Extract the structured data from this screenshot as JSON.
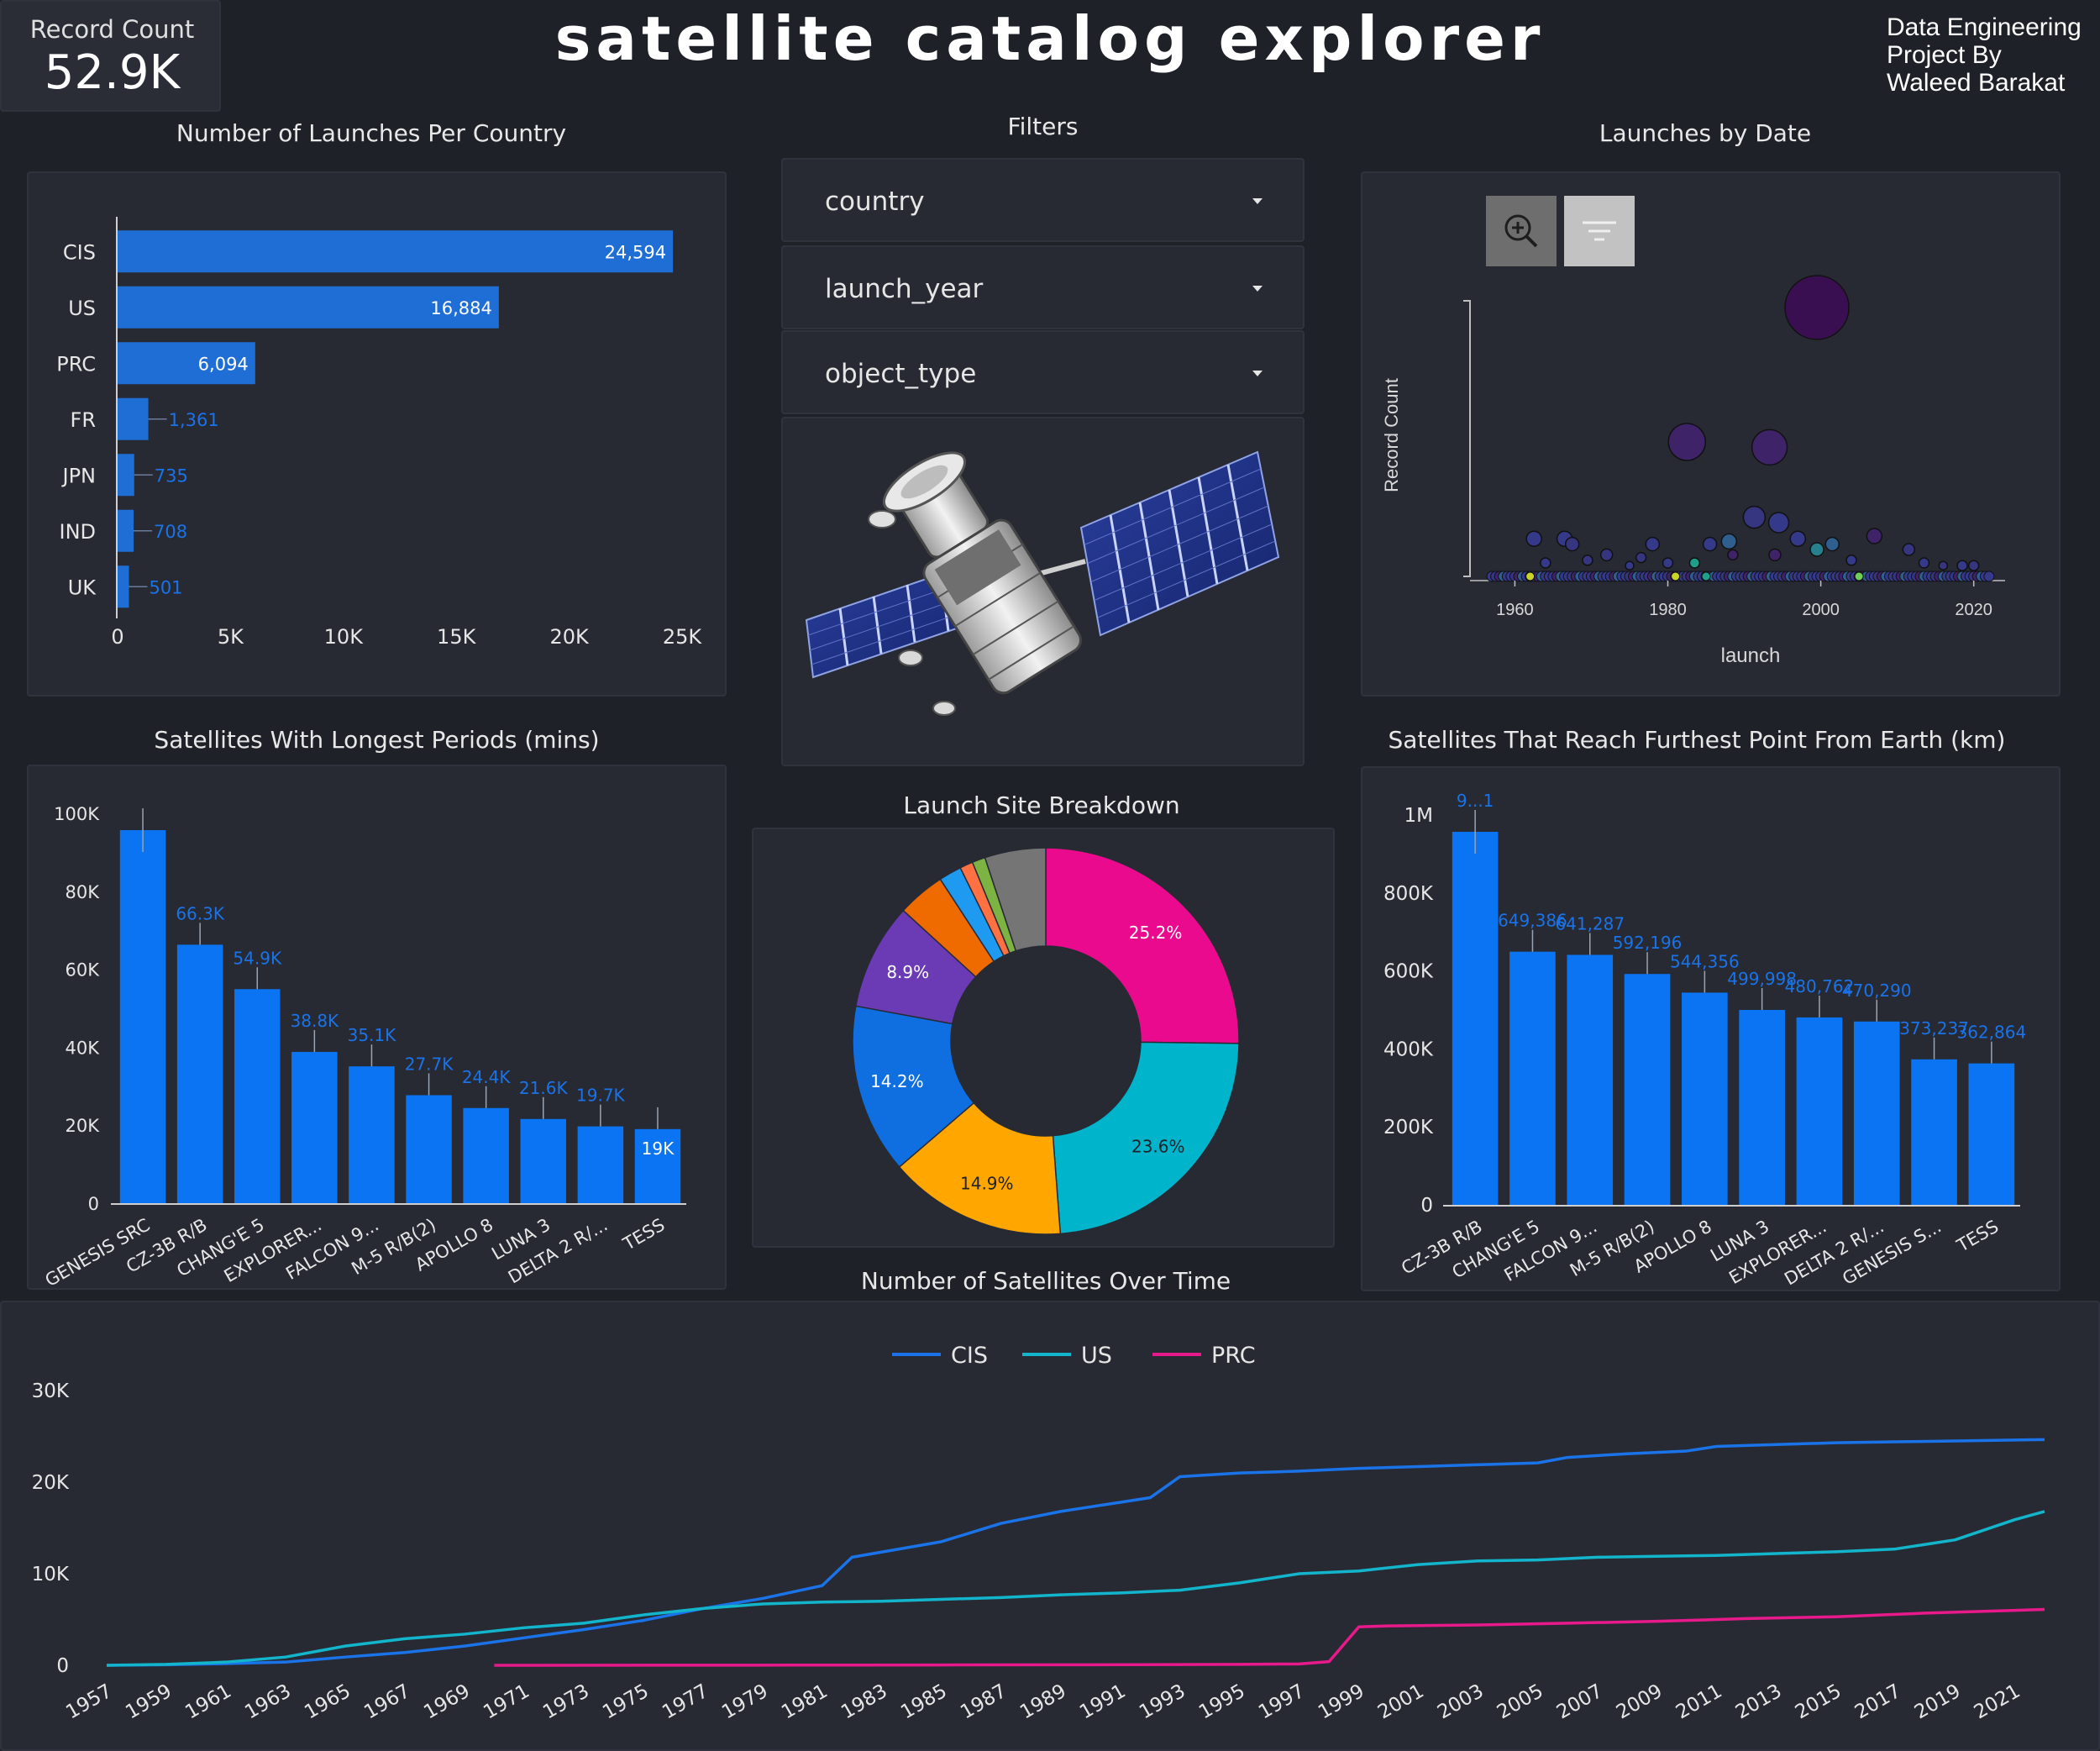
{
  "header": {
    "title": "satellite catalog explorer",
    "kpi_label": "Record Count",
    "kpi_value": "52.9K",
    "credits": [
      "Data Engineering",
      "Project By",
      "Waleed Barakat"
    ]
  },
  "filters": {
    "title": "Filters",
    "items": [
      "country",
      "launch_year",
      "object_type"
    ]
  },
  "colors": {
    "bg": "#1f2128",
    "panel": "#272a33",
    "bar_dark": "#1e6ed6",
    "bar_bright": "#0b74f2",
    "cis": "#1a73e8",
    "us": "#12b5cb",
    "prc": "#e8198b"
  },
  "chart_data": [
    {
      "id": "launches_per_country",
      "type": "bar",
      "orientation": "horizontal",
      "title": "Number of Launches Per Country",
      "categories": [
        "CIS",
        "US",
        "PRC",
        "FR",
        "JPN",
        "IND",
        "UK"
      ],
      "values": [
        24594,
        16884,
        6094,
        1361,
        735,
        708,
        501
      ],
      "value_labels": [
        "24,594",
        "16,884",
        "6,094",
        "1,361",
        "735",
        "708",
        "501"
      ],
      "xlim": [
        0,
        25000
      ],
      "xticks": [
        0,
        5000,
        10000,
        15000,
        20000,
        25000
      ],
      "xtick_labels": [
        "0",
        "5K",
        "10K",
        "15K",
        "20K",
        "25K"
      ]
    },
    {
      "id": "launches_by_date",
      "type": "scatter",
      "title": "Launches by Date",
      "xlabel": "launch",
      "ylabel": "Record Count",
      "xtick_labels": [
        "1960",
        "1980",
        "2000",
        "2020"
      ],
      "xticks": [
        1960,
        1980,
        2000,
        2020
      ],
      "xlim": [
        1956,
        2023
      ],
      "points": [
        {
          "x": 1999.5,
          "y": 10.0,
          "r": 38,
          "color": "#3a0f52"
        },
        {
          "x": 1982.5,
          "y": 5.0,
          "r": 22,
          "color": "#3e2369"
        },
        {
          "x": 1993.3,
          "y": 4.8,
          "r": 21,
          "color": "#3e2369"
        },
        {
          "x": 1991.3,
          "y": 2.2,
          "r": 13,
          "color": "#36357f"
        },
        {
          "x": 1994.5,
          "y": 2.0,
          "r": 12,
          "color": "#34398a"
        },
        {
          "x": 1962.5,
          "y": 1.4,
          "r": 9,
          "color": "#34398a"
        },
        {
          "x": 1966.5,
          "y": 1.4,
          "r": 9,
          "color": "#34398a"
        },
        {
          "x": 1967.5,
          "y": 1.2,
          "r": 8,
          "color": "#36357f"
        },
        {
          "x": 1978.0,
          "y": 1.2,
          "r": 8,
          "color": "#34398a"
        },
        {
          "x": 1985.5,
          "y": 1.2,
          "r": 8,
          "color": "#34398a"
        },
        {
          "x": 1988.0,
          "y": 1.3,
          "r": 9,
          "color": "#2f5f8e"
        },
        {
          "x": 1997.0,
          "y": 1.4,
          "r": 9,
          "color": "#34398a"
        },
        {
          "x": 2001.5,
          "y": 1.2,
          "r": 8,
          "color": "#2f5f8e"
        },
        {
          "x": 1999.5,
          "y": 1.0,
          "r": 8,
          "color": "#27808d"
        },
        {
          "x": 2007.0,
          "y": 1.5,
          "r": 9,
          "color": "#3e2369"
        },
        {
          "x": 2011.5,
          "y": 1.0,
          "r": 7,
          "color": "#36357f"
        },
        {
          "x": 1994.0,
          "y": 0.8,
          "r": 7,
          "color": "#3e2369"
        },
        {
          "x": 1988.5,
          "y": 0.8,
          "r": 6,
          "color": "#3e2369"
        },
        {
          "x": 1976.5,
          "y": 0.7,
          "r": 6,
          "color": "#36357f"
        },
        {
          "x": 1972.0,
          "y": 0.8,
          "r": 7,
          "color": "#36357f"
        },
        {
          "x": 1969.5,
          "y": 0.6,
          "r": 6,
          "color": "#36357f"
        },
        {
          "x": 1964.0,
          "y": 0.5,
          "r": 6,
          "color": "#34398a"
        },
        {
          "x": 2004.0,
          "y": 0.6,
          "r": 6,
          "color": "#34398a"
        },
        {
          "x": 2013.5,
          "y": 0.5,
          "r": 6,
          "color": "#34398a"
        },
        {
          "x": 2018.5,
          "y": 0.4,
          "r": 6,
          "color": "#34398a"
        },
        {
          "x": 1983.5,
          "y": 0.5,
          "r": 6,
          "color": "#1f9e89"
        },
        {
          "x": 1980.0,
          "y": 0.5,
          "r": 6,
          "color": "#34398a"
        },
        {
          "x": 2016.0,
          "y": 0.4,
          "r": 5,
          "color": "#36357f"
        },
        {
          "x": 1975.0,
          "y": 0.4,
          "r": 5,
          "color": "#34398a"
        },
        {
          "x": 2020.0,
          "y": 0.4,
          "r": 6,
          "color": "#36357f"
        }
      ]
    },
    {
      "id": "longest_periods",
      "type": "bar",
      "title": "Satellites With Longest Periods (mins)",
      "categories": [
        "GENESIS SRC",
        "CZ-3B R/B",
        "CHANG'E 5",
        "EXPLORER...",
        "FALCON 9...",
        "M-5 R/B(2)",
        "APOLLO 8",
        "LUNA 3",
        "DELTA 2 R/...",
        "TESS"
      ],
      "values": [
        96000,
        66300,
        54900,
        38800,
        35100,
        27700,
        24400,
        21600,
        19700,
        19000
      ],
      "value_labels": [
        "",
        "66.3K",
        "54.9K",
        "38.8K",
        "35.1K",
        "27.7K",
        "24.4K",
        "21.6K",
        "19.7K",
        "19K"
      ],
      "ylim": [
        0,
        100000
      ],
      "yticks": [
        0,
        20000,
        40000,
        60000,
        80000,
        100000
      ],
      "ytick_labels": [
        "0",
        "20K",
        "40K",
        "60K",
        "80K",
        "100K"
      ]
    },
    {
      "id": "launch_site_breakdown",
      "type": "pie",
      "title": "Launch Site Breakdown",
      "slices": [
        {
          "value": 25.2,
          "label": "25.2%",
          "color": "#ea0a8e"
        },
        {
          "value": 23.6,
          "label": "23.6%",
          "color": "#00b4cc"
        },
        {
          "value": 14.9,
          "label": "14.9%",
          "color": "#ffa600"
        },
        {
          "value": 14.2,
          "label": "14.2%",
          "color": "#0f6fe0"
        },
        {
          "value": 8.9,
          "label": "8.9%",
          "color": "#6a3bb5"
        },
        {
          "value": 4.0,
          "label": "",
          "color": "#ef6b00"
        },
        {
          "value": 1.9,
          "label": "",
          "color": "#1e9bf0"
        },
        {
          "value": 1.1,
          "label": "",
          "color": "#ff7043"
        },
        {
          "value": 1.1,
          "label": "",
          "color": "#7cb342"
        },
        {
          "value": 5.1,
          "label": "",
          "color": "#757575"
        }
      ]
    },
    {
      "id": "furthest_point",
      "type": "bar",
      "title": "Satellites That Reach Furthest Point From Earth (km)",
      "categories": [
        "CZ-3B R/B",
        "CHANG'E 5",
        "FALCON 9...",
        "M-5 R/B(2)",
        "APOLLO 8",
        "LUNA 3",
        "EXPLORER...",
        "DELTA 2 R/...",
        "GENESIS S...",
        "TESS"
      ],
      "values": [
        963000,
        649386,
        641287,
        592196,
        544356,
        499998,
        480762,
        470290,
        373237,
        362864
      ],
      "value_labels": [
        "9...1",
        "649,386",
        "641,287",
        "592,196",
        "544,356",
        "499,998",
        "480,762",
        "470,290",
        "373,237",
        "362,864"
      ],
      "ylim": [
        0,
        1000000
      ],
      "yticks": [
        0,
        200000,
        400000,
        600000,
        800000,
        1000000
      ],
      "ytick_labels": [
        "0",
        "200K",
        "400K",
        "600K",
        "800K",
        "1M"
      ]
    },
    {
      "id": "satellites_over_time",
      "type": "line",
      "title": "Number of Satellites Over Time",
      "xlim": [
        1957,
        2022
      ],
      "ylim": [
        0,
        30000
      ],
      "yticks": [
        0,
        10000,
        20000,
        30000
      ],
      "ytick_labels": [
        "0",
        "10K",
        "20K",
        "30K"
      ],
      "xtick_labels": [
        "1957",
        "1959",
        "1961",
        "1963",
        "1965",
        "1967",
        "1969",
        "1971",
        "1973",
        "1975",
        "1977",
        "1979",
        "1981",
        "1983",
        "1985",
        "1987",
        "1989",
        "1991",
        "1993",
        "1995",
        "1997",
        "1999",
        "2001",
        "2003",
        "2005",
        "2007",
        "2009",
        "2011",
        "2013",
        "2015",
        "2017",
        "2019",
        "2021"
      ],
      "series": [
        {
          "name": "CIS",
          "color": "#1a73e8",
          "x": [
            1957,
            1959,
            1961,
            1963,
            1965,
            1967,
            1969,
            1971,
            1973,
            1975,
            1977,
            1979,
            1981,
            1982,
            1985,
            1987,
            1989,
            1991,
            1992,
            1993,
            1995,
            1997,
            1999,
            2001,
            2003,
            2005,
            2006,
            2008,
            2010,
            2011,
            2013,
            2015,
            2017,
            2019,
            2021,
            2022
          ],
          "y": [
            0,
            60,
            180,
            350,
            900,
            1400,
            2100,
            3000,
            3900,
            4900,
            6200,
            7300,
            8700,
            11800,
            13500,
            15500,
            16800,
            17800,
            18300,
            20600,
            21000,
            21200,
            21500,
            21700,
            21900,
            22100,
            22700,
            23100,
            23400,
            23900,
            24100,
            24300,
            24400,
            24500,
            24600,
            24650
          ]
        },
        {
          "name": "US",
          "color": "#12b5cb",
          "x": [
            1957,
            1959,
            1961,
            1963,
            1965,
            1967,
            1969,
            1971,
            1973,
            1975,
            1977,
            1979,
            1981,
            1983,
            1985,
            1987,
            1989,
            1991,
            1993,
            1995,
            1997,
            1999,
            2001,
            2003,
            2005,
            2007,
            2009,
            2011,
            2013,
            2015,
            2017,
            2019,
            2021,
            2022
          ],
          "y": [
            0,
            100,
            350,
            900,
            2100,
            2900,
            3400,
            4100,
            4600,
            5500,
            6200,
            6700,
            6900,
            7000,
            7200,
            7400,
            7700,
            7900,
            8200,
            9000,
            10000,
            10300,
            11000,
            11400,
            11500,
            11800,
            11900,
            12000,
            12200,
            12400,
            12700,
            13700,
            15900,
            16800
          ]
        },
        {
          "name": "PRC",
          "color": "#e8198b",
          "x": [
            1970,
            1975,
            1980,
            1985,
            1990,
            1995,
            1997,
            1998,
            1999,
            2000,
            2003,
            2006,
            2009,
            2012,
            2015,
            2018,
            2021,
            2022
          ],
          "y": [
            0,
            10,
            20,
            40,
            60,
            100,
            150,
            400,
            4200,
            4300,
            4400,
            4600,
            4800,
            5100,
            5300,
            5700,
            6000,
            6100
          ]
        }
      ]
    }
  ]
}
